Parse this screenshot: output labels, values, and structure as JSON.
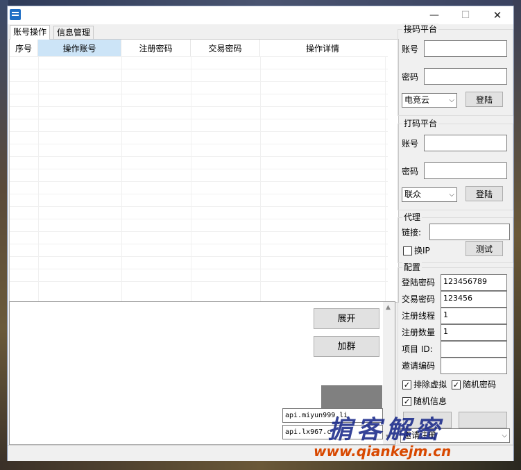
{
  "window": {
    "title": "",
    "controls": {
      "minimize": "—",
      "maximize": "☐",
      "close": "✕"
    }
  },
  "tabs": [
    {
      "label": "账号操作",
      "active": true
    },
    {
      "label": "信息管理",
      "active": false
    }
  ],
  "grid": {
    "columns": [
      "序号",
      "操作账号",
      "注册密码",
      "交易密码",
      "操作详情"
    ],
    "selected_column": "操作账号",
    "rows": []
  },
  "log": {
    "buttons": {
      "expand": "展开",
      "add_group": "加群"
    },
    "api_fields": [
      "api.miyun999.li",
      "api.lx967.c"
    ]
  },
  "receive_platform": {
    "title": "接码平台",
    "account_label": "账号",
    "account_value": "",
    "password_label": "密码",
    "password_value": "",
    "provider": "电竞云",
    "login_label": "登陆"
  },
  "captcha_platform": {
    "title": "打码平台",
    "account_label": "账号",
    "account_value": "",
    "password_label": "密码",
    "password_value": "",
    "provider": "联众",
    "login_label": "登陆"
  },
  "proxy": {
    "title": "代理",
    "link_label": "链接:",
    "link_value": "",
    "switch_ip_label": "换IP",
    "switch_ip_checked": false,
    "test_label": "测试"
  },
  "config": {
    "title": "配置",
    "fields": [
      {
        "label": "登陆密码",
        "value": "123456789"
      },
      {
        "label": "交易密码",
        "value": "123456"
      },
      {
        "label": "注册线程",
        "value": "1"
      },
      {
        "label": "注册数量",
        "value": "1"
      },
      {
        "label": "项目 ID:",
        "value": ""
      },
      {
        "label": "邀请编码",
        "value": ""
      }
    ],
    "checkboxes": [
      {
        "label": "排除虚拟",
        "checked": true
      },
      {
        "label": "随机密码",
        "checked": true
      },
      {
        "label": "随机信息",
        "checked": true
      }
    ],
    "mode_select": "邀请注册"
  },
  "watermark": {
    "top": "掮客解密",
    "bottom": "www.qiankejm.cn"
  }
}
